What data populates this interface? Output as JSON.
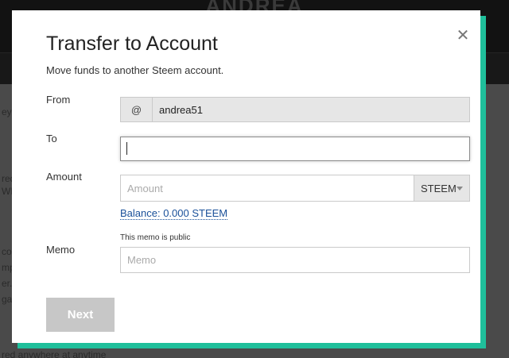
{
  "background": {
    "title": "ANDREA",
    "fragments": [
      "eys",
      "red",
      "WE",
      "co",
      "mp",
      "er.",
      "ga",
      "red anywhere at anytime"
    ]
  },
  "modal": {
    "title": "Transfer to Account",
    "subtitle": "Move funds to another Steem account.",
    "close_icon": "close-icon",
    "accent_color": "#1fbf9b"
  },
  "form": {
    "from": {
      "label": "From",
      "prefix": "@",
      "value": "andrea51"
    },
    "to": {
      "label": "To",
      "value": "",
      "placeholder": ""
    },
    "amount": {
      "label": "Amount",
      "placeholder": "Amount",
      "value": "",
      "asset_selected": "STEEM"
    },
    "balance_text": "Balance: 0.000 STEEM",
    "memo": {
      "label": "Memo",
      "hint": "This memo is public",
      "placeholder": "Memo",
      "value": ""
    },
    "next_label": "Next"
  }
}
